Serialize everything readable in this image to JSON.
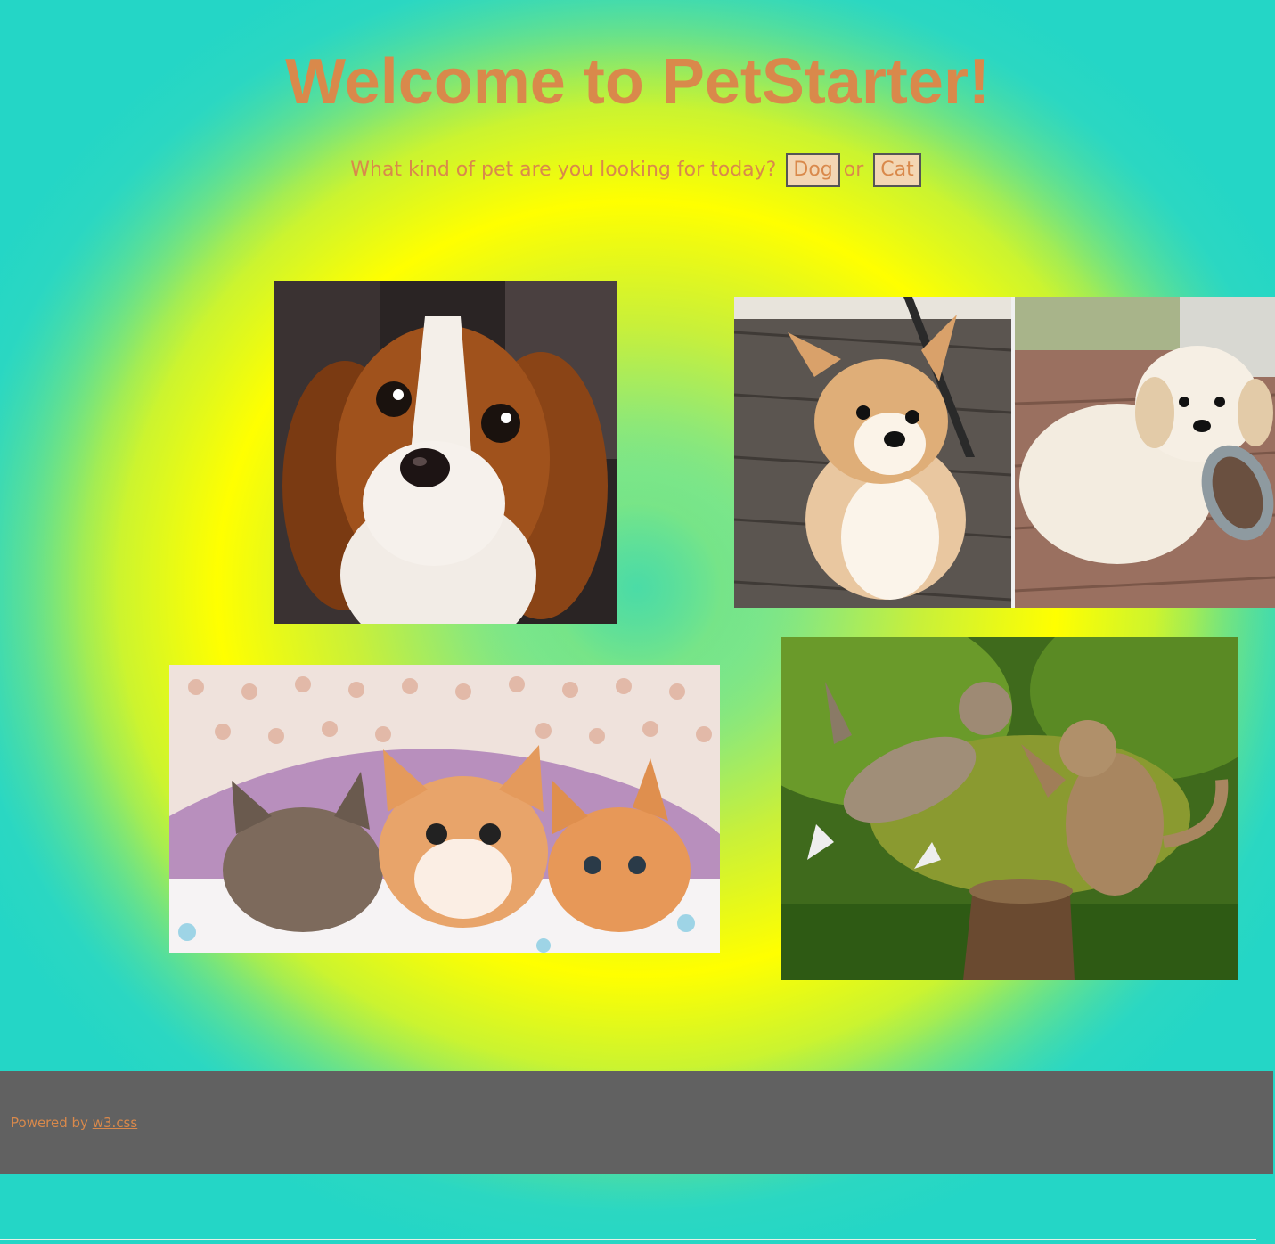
{
  "header": {
    "title": "Welcome to PetStarter!"
  },
  "prompt": {
    "question": "What kind of pet are you looking for today?",
    "dog_button": "Dog",
    "connector": "or",
    "cat_button": "Cat"
  },
  "gallery": {
    "images": [
      {
        "subject": "cavalier-puppy-photo"
      },
      {
        "subject": "corgi-and-retriever-puppies-photo"
      },
      {
        "subject": "three-kittens-under-blanket-photo"
      },
      {
        "subject": "two-kittens-playing-photo"
      }
    ]
  },
  "footer": {
    "powered_by": "Powered by",
    "link_text": "w3.css"
  },
  "colors": {
    "text_accent": "#d9894b",
    "footer_bg": "#616161",
    "button_bg": "#f3d6b3"
  }
}
